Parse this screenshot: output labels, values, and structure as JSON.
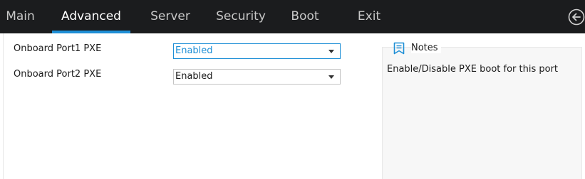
{
  "tabs": [
    {
      "label": "Main"
    },
    {
      "label": "Advanced"
    },
    {
      "label": "Server"
    },
    {
      "label": "Security"
    },
    {
      "label": "Boot"
    },
    {
      "label": "Exit"
    }
  ],
  "active_tab": "Advanced",
  "settings": [
    {
      "label": "Onboard Port1 PXE",
      "value": "Enabled"
    },
    {
      "label": "Onboard Port2 PXE",
      "value": "Enabled"
    }
  ],
  "notes": {
    "title": "Notes",
    "text": "Enable/Disable PXE boot for this port"
  },
  "colors": {
    "accent": "#1e8fd6",
    "topbar": "#1b1c1e"
  }
}
